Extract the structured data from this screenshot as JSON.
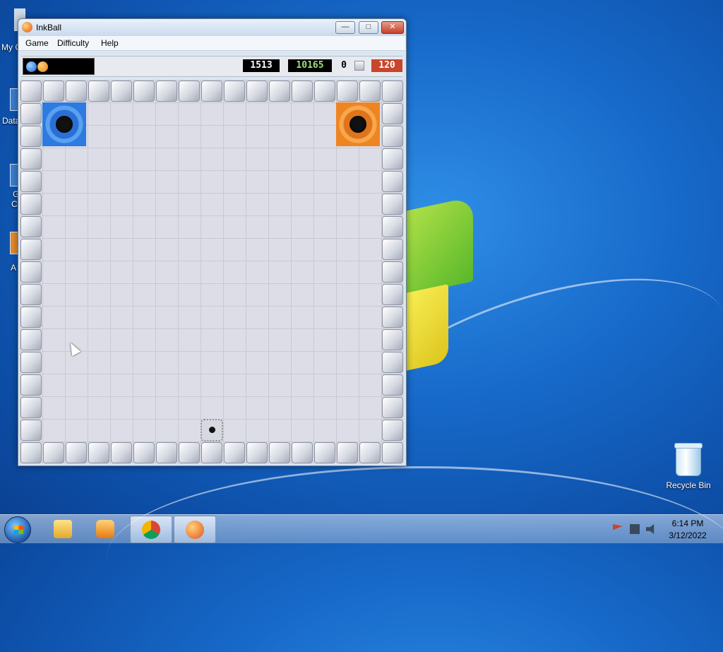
{
  "desktop": {
    "recycle_bin_label": "Recycle Bin",
    "partial_labels": [
      "My C",
      "Data",
      "G",
      "C",
      "A"
    ]
  },
  "window": {
    "title": "InkBall",
    "buttons": {
      "minimize": "—",
      "maximize": "□",
      "close": "✕"
    },
    "menu": [
      "Game",
      "Difficulty",
      "Help"
    ]
  },
  "status": {
    "ball_queue": [
      "blue",
      "orange"
    ],
    "score": "1513",
    "high_score": "10165",
    "blocks_count": "0",
    "timer": "120",
    "colors": {
      "score_text": "#ffffff",
      "high_score_text": "#9ee07a",
      "timer_bg": "#c9452b"
    }
  },
  "board": {
    "holes": [
      {
        "color": "blue"
      },
      {
        "color": "orange"
      }
    ],
    "spawner": "ball-spawner"
  },
  "taskbar": {
    "apps": [
      "windows-explorer",
      "media-player",
      "chrome",
      "inkball"
    ],
    "time": "6:14 PM",
    "date": "3/12/2022"
  }
}
